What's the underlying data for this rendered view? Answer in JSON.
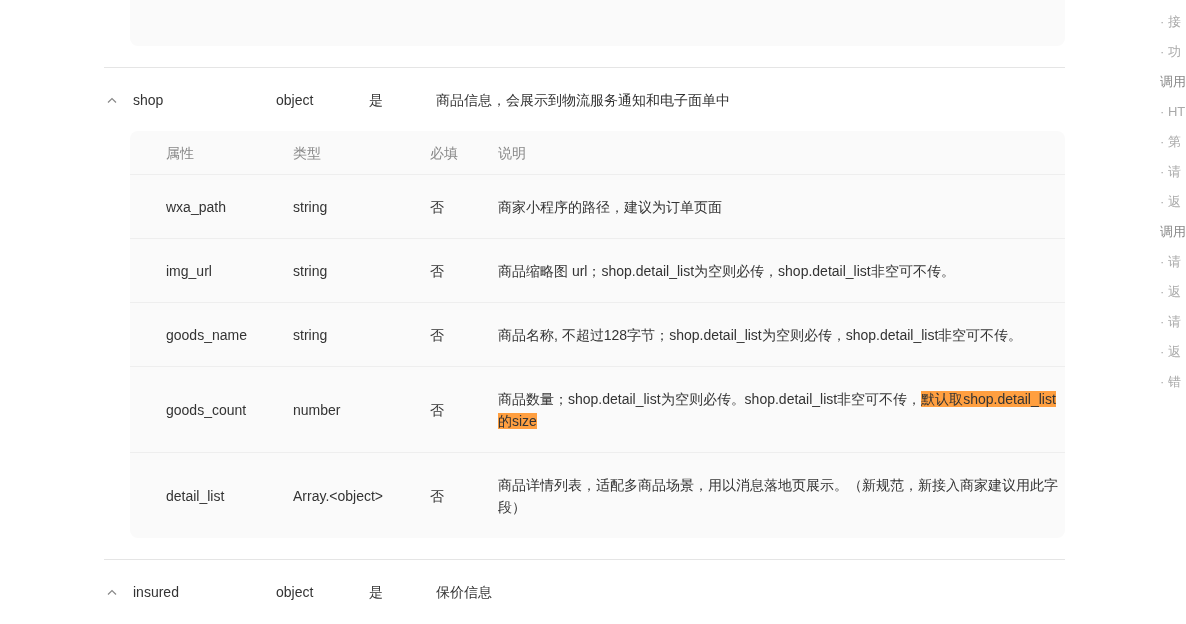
{
  "fields": [
    {
      "name": "shop",
      "type": "object",
      "required": "是",
      "description": "商品信息，会展示到物流服务通知和电子面单中",
      "expanded": true,
      "sub_table": {
        "columns": [
          "属性",
          "类型",
          "必填",
          "说明"
        ],
        "rows": [
          {
            "name": "wxa_path",
            "type": "string",
            "required": "否",
            "description": "商家小程序的路径，建议为订单页面"
          },
          {
            "name": "img_url",
            "type": "string",
            "required": "否",
            "description": "商品缩略图 url；shop.detail_list为空则必传，shop.detail_list非空可不传。"
          },
          {
            "name": "goods_name",
            "type": "string",
            "required": "否",
            "description": "商品名称, 不超过128字节；shop.detail_list为空则必传，shop.detail_list非空可不传。"
          },
          {
            "name": "goods_count",
            "type": "number",
            "required": "否",
            "description": "商品数量；shop.detail_list为空则必传。shop.detail_list非空可不传，",
            "highlight": "默认取shop.detail_list的size"
          },
          {
            "name": "detail_list",
            "type": "Array.<object>",
            "required": "否",
            "description": "商品详情列表，适配多商品场景，用以消息落地页展示。（新规范，新接入商家建议用此字段）"
          }
        ]
      }
    },
    {
      "name": "insured",
      "type": "object",
      "required": "是",
      "description": "保价信息",
      "expanded": true
    }
  ],
  "toc": [
    {
      "kind": "item",
      "label": "· 接"
    },
    {
      "kind": "item",
      "label": "· 功"
    },
    {
      "kind": "heading",
      "label": "调用"
    },
    {
      "kind": "item",
      "label": "· HT"
    },
    {
      "kind": "item",
      "label": "· 第"
    },
    {
      "kind": "item",
      "label": "· 请"
    },
    {
      "kind": "item",
      "label": "· 返"
    },
    {
      "kind": "heading",
      "label": "调用"
    },
    {
      "kind": "item",
      "label": "· 请"
    },
    {
      "kind": "item",
      "label": "· 返"
    },
    {
      "kind": "item",
      "label": "· 请"
    },
    {
      "kind": "item",
      "label": "· 返"
    },
    {
      "kind": "item",
      "label": "· 错"
    }
  ]
}
